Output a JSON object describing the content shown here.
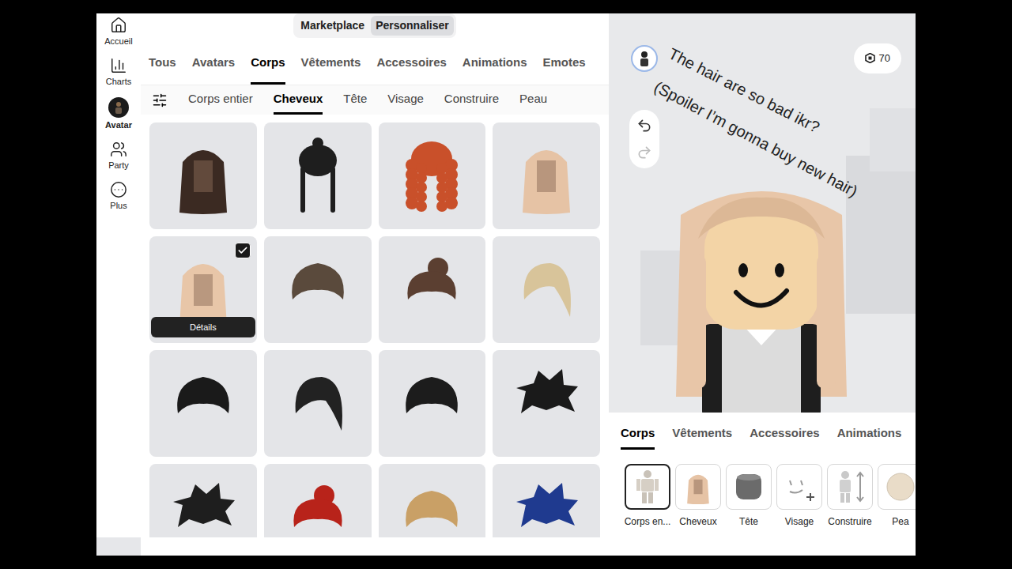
{
  "sidebar": {
    "items": [
      {
        "label": "Accueil",
        "icon": "home",
        "selected": false
      },
      {
        "label": "Charts",
        "icon": "charts",
        "selected": false
      },
      {
        "label": "Avatar",
        "icon": "avatar",
        "selected": true
      },
      {
        "label": "Party",
        "icon": "party",
        "selected": false
      },
      {
        "label": "Plus",
        "icon": "more",
        "selected": false
      }
    ]
  },
  "top_toggle": [
    {
      "label": "Marketplace",
      "selected": false
    },
    {
      "label": "Personnaliser",
      "selected": true
    }
  ],
  "category_tabs": [
    {
      "label": "Tous",
      "selected": false
    },
    {
      "label": "Avatars",
      "selected": false
    },
    {
      "label": "Corps",
      "selected": true
    },
    {
      "label": "Vêtements",
      "selected": false
    },
    {
      "label": "Accessoires",
      "selected": false
    },
    {
      "label": "Animations",
      "selected": false
    },
    {
      "label": "Emotes",
      "selected": false
    }
  ],
  "sub_tabs": [
    {
      "label": "Corps entier",
      "selected": false
    },
    {
      "label": "Cheveux",
      "selected": true
    },
    {
      "label": "Tête",
      "selected": false
    },
    {
      "label": "Visage",
      "selected": false
    },
    {
      "label": "Construire",
      "selected": false
    },
    {
      "label": "Peau",
      "selected": false
    }
  ],
  "grid": {
    "action": "Détails",
    "items": [
      {
        "kind": "long",
        "color": "#3b2a22",
        "selected": false
      },
      {
        "kind": "braids",
        "color": "#1e1e1e",
        "selected": false
      },
      {
        "kind": "curly",
        "color": "#c9502a",
        "selected": false
      },
      {
        "kind": "long",
        "color": "#e6c3a5",
        "selected": false
      },
      {
        "kind": "long",
        "color": "#e8c6a8",
        "selected": true
      },
      {
        "kind": "short",
        "color": "#5a4a3c",
        "selected": false
      },
      {
        "kind": "bun",
        "color": "#5b3f31",
        "selected": false
      },
      {
        "kind": "bob",
        "color": "#d8c49a",
        "selected": false
      },
      {
        "kind": "short",
        "color": "#1a1a1a",
        "selected": false
      },
      {
        "kind": "bob",
        "color": "#222222",
        "selected": false
      },
      {
        "kind": "short",
        "color": "#1c1c1c",
        "selected": false
      },
      {
        "kind": "spiky",
        "color": "#1a1a1a",
        "selected": false
      },
      {
        "kind": "spiky",
        "color": "#1e1e1e",
        "selected": false
      },
      {
        "kind": "bun",
        "color": "#b8231a",
        "selected": false
      },
      {
        "kind": "short",
        "color": "#c9a066",
        "selected": false
      },
      {
        "kind": "spiky",
        "color": "#1f3a8f",
        "selected": false
      }
    ]
  },
  "overlay_notes": [
    "The hair are so bad ikr?",
    "(Spoiler I’m gonna buy new hair)"
  ],
  "robux": "70",
  "bottom_tabs": [
    {
      "label": "Corps",
      "selected": true
    },
    {
      "label": "Vêtements",
      "selected": false
    },
    {
      "label": "Accessoires",
      "selected": false
    },
    {
      "label": "Animations",
      "selected": false
    }
  ],
  "equipped": [
    {
      "label": "Corps en...",
      "kind": "body",
      "selected": true
    },
    {
      "label": "Cheveux",
      "kind": "hair",
      "selected": false
    },
    {
      "label": "Tête",
      "kind": "head",
      "selected": false
    },
    {
      "label": "Visage",
      "kind": "face",
      "selected": false
    },
    {
      "label": "Construire",
      "kind": "build",
      "selected": false
    },
    {
      "label": "Pea",
      "kind": "skin",
      "selected": false
    }
  ]
}
